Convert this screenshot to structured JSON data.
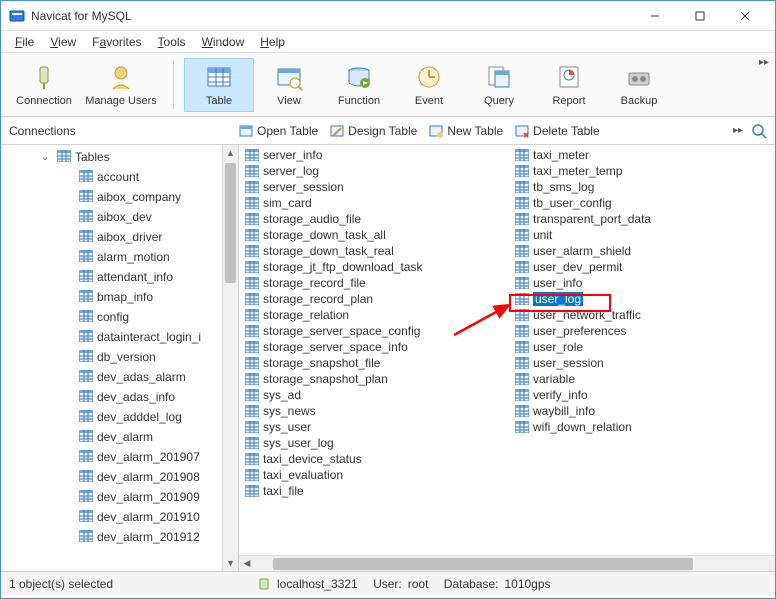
{
  "title": "Navicat for MySQL",
  "menubar": [
    "File",
    "View",
    "Favorites",
    "Tools",
    "Window",
    "Help"
  ],
  "toolbar": {
    "connection": "Connection",
    "manage_users": "Manage Users",
    "table": "Table",
    "view": "View",
    "function": "Function",
    "event": "Event",
    "query": "Query",
    "report": "Report",
    "backup": "Backup"
  },
  "subtoolbar": {
    "left": "Connections",
    "open_table": "Open Table",
    "design_table": "Design Table",
    "new_table": "New Table",
    "delete_table": "Delete Table"
  },
  "sidebar": {
    "root": "Tables",
    "items": [
      "account",
      "aibox_company",
      "aibox_dev",
      "aibox_driver",
      "alarm_motion",
      "attendant_info",
      "bmap_info",
      "config",
      "datainteract_login_i",
      "db_version",
      "dev_adas_alarm",
      "dev_adas_info",
      "dev_adddel_log",
      "dev_alarm",
      "dev_alarm_201907",
      "dev_alarm_201908",
      "dev_alarm_201909",
      "dev_alarm_201910",
      "dev_alarm_201912"
    ]
  },
  "content": {
    "col1": [
      "server_info",
      "server_log",
      "server_session",
      "sim_card",
      "storage_audio_file",
      "storage_down_task_all",
      "storage_down_task_real",
      "storage_jt_ftp_download_task",
      "storage_record_file",
      "storage_record_plan",
      "storage_relation",
      "storage_server_space_config",
      "storage_server_space_info",
      "storage_snapshot_file",
      "storage_snapshot_plan",
      "sys_ad",
      "sys_news",
      "sys_user",
      "sys_user_log",
      "taxi_device_status",
      "taxi_evaluation",
      "taxi_file"
    ],
    "col2": [
      "taxi_meter",
      "taxi_meter_temp",
      "tb_sms_log",
      "tb_user_config",
      "transparent_port_data",
      "unit",
      "user_alarm_shield",
      "user_dev_permit",
      "user_info",
      "user_log",
      "user_network_traffic",
      "user_preferences",
      "user_role",
      "user_session",
      "variable",
      "verify_info",
      "waybill_info",
      "wifi_down_relation"
    ],
    "highlighted_index": 9
  },
  "statusbar": {
    "left": "1 object(s) selected",
    "host": "localhost_3321",
    "user_label": "User:",
    "user": "root",
    "db_label": "Database:",
    "db": "1010gps"
  }
}
